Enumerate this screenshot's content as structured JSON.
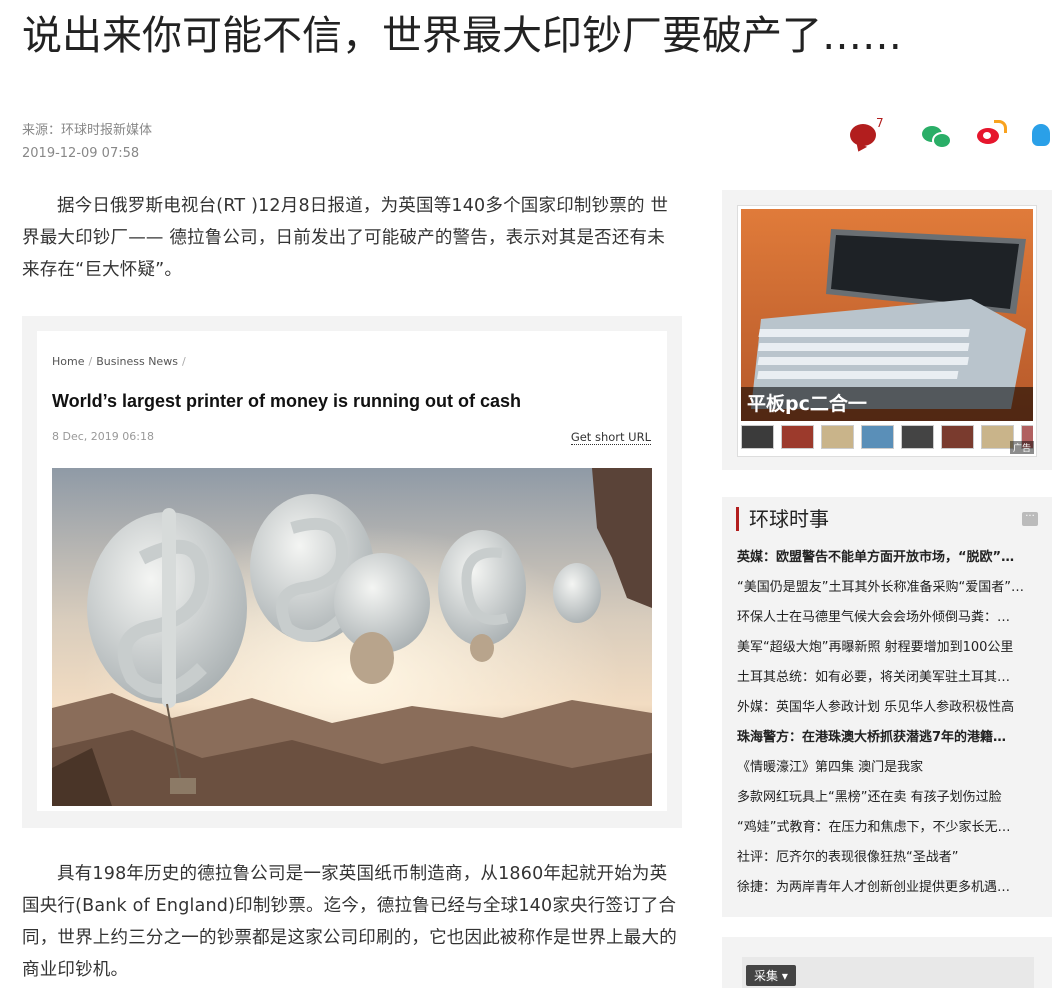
{
  "article": {
    "title": "说出来你可能不信，世界最大印钞厂要破产了……",
    "source": "来源：环球时报新媒体",
    "date": "2019-12-09 07:58",
    "comment_count": "7",
    "paragraph1": "据今日俄罗斯电视台(RT )12月8日报道，为英国等140多个国家印制钞票的 世界最大印钞厂—— 德拉鲁公司，日前发出了可能破产的警告，表示对其是否还有未来存在“巨大怀疑”。",
    "paragraph2": "具有198年历史的德拉鲁公司是一家英国纸币制造商，从1860年起就开始为英国央行(Bank of England)印制钞票。迄今，德拉鲁已经与全球140家央行签订了合同，世界上约三分之一的钞票都是这家公司印刷的，它也因此被称作是世界上最大的商业印钞机。"
  },
  "share": {
    "icons": [
      "comment-icon",
      "wechat-icon",
      "weibo-icon",
      "qq-icon"
    ]
  },
  "figure": {
    "crumb_home": "Home",
    "crumb_sep": "/",
    "crumb_section": "Business News",
    "title": "World’s largest printer of money is running out of cash",
    "date": "8 Dec, 2019 06:18",
    "short_url": "Get short URL"
  },
  "sidebar_ad": {
    "caption": "平板pc二合一",
    "tag": "广告"
  },
  "news": {
    "heading": "环球时事",
    "items": [
      {
        "text": "英媒：欧盟警告不能单方面开放市场，“脱欧”…",
        "bold": true
      },
      {
        "text": "“美国仍是盟友”土耳其外长称准备采购“爱国者”…",
        "bold": false
      },
      {
        "text": "环保人士在马德里气候大会会场外倾倒马粪：…",
        "bold": false
      },
      {
        "text": "美军“超级大炮”再曝新照 射程要增加到100公里",
        "bold": false
      },
      {
        "text": "土耳其总统：如有必要，将关闭美军驻土耳其…",
        "bold": false
      },
      {
        "text": "外媒：英国华人参政计划 乐见华人参政积极性高",
        "bold": false
      },
      {
        "text": "珠海警方：在港珠澳大桥抓获潜逃7年的港籍…",
        "bold": true
      },
      {
        "text": "《情暖濠江》第四集 澳门是我家",
        "bold": false
      },
      {
        "text": "多款网红玩具上“黑榜”还在卖 有孩子划伤过脸",
        "bold": false
      },
      {
        "text": "“鸡娃”式教育：在压力和焦虑下，不少家长无…",
        "bold": false
      },
      {
        "text": "社评：厄齐尔的表现很像狂热“圣战者”",
        "bold": false
      },
      {
        "text": "徐捷：为两岸青年人才创新创业提供更多机遇…",
        "bold": false
      }
    ]
  },
  "bottom_ad": {
    "label": "采集"
  }
}
